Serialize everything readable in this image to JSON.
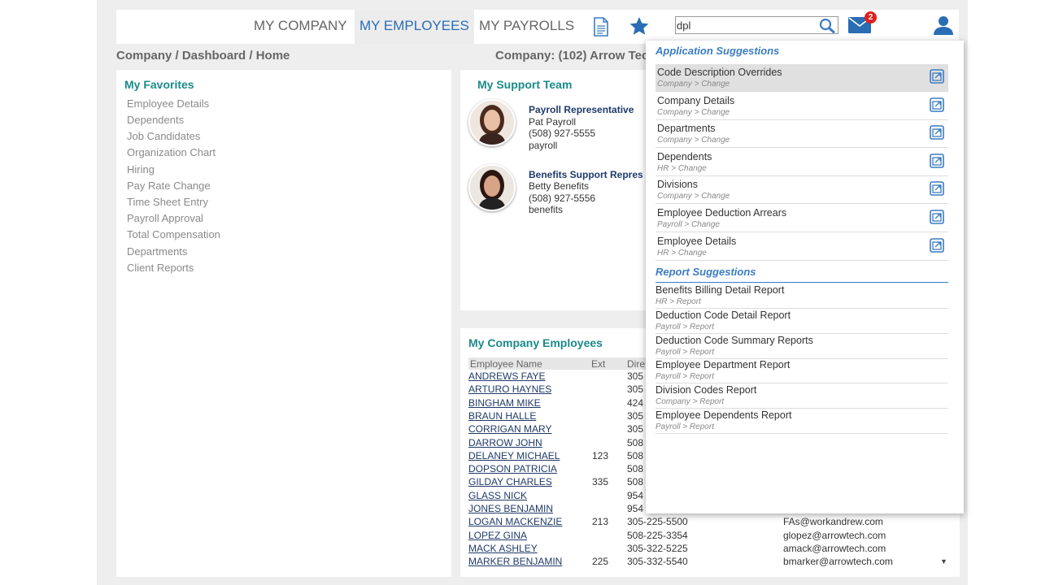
{
  "nav": {
    "items": [
      "MY COMPANY",
      "MY EMPLOYEES",
      "MY PAYROLLS"
    ],
    "active": "MY EMPLOYEES"
  },
  "header": {
    "search_value": "dpl",
    "mail_badge": "2"
  },
  "breadcrumb": "Company / Dashboard / Home",
  "company_label": "Company: (102) Arrow Tec",
  "favorites": {
    "title": "My Favorites",
    "items": [
      "Employee Details",
      "Dependents",
      "Job Candidates",
      "Organization Chart",
      "Hiring",
      "Pay Rate Change",
      "Time Sheet Entry",
      "Payroll Approval",
      "Total Compensation",
      "Departments",
      "Client Reports"
    ]
  },
  "support": {
    "title": "My Support Team",
    "members": [
      {
        "role": "Payroll Representative",
        "name": "Pat Payroll",
        "phone": "(508) 927-5555",
        "email": "payroll"
      },
      {
        "role": "Benefits Support Repres",
        "name": "Betty Benefits",
        "phone": "(508) 927-5556",
        "email": "benefits"
      }
    ]
  },
  "employees": {
    "title": "My Company Employees",
    "columns": [
      "Employee Name",
      "Ext",
      "Dire"
    ],
    "rows": [
      {
        "name": "ANDREWS FAYE",
        "ext": "",
        "phone": "305",
        "email": ""
      },
      {
        "name": "ARTURO HAYNES",
        "ext": "",
        "phone": "305",
        "email": ""
      },
      {
        "name": "BINGHAM MIKE",
        "ext": "",
        "phone": "424",
        "email": ""
      },
      {
        "name": "BRAUN HALLE",
        "ext": "",
        "phone": "305",
        "email": ""
      },
      {
        "name": "CORRIGAN MARY",
        "ext": "",
        "phone": "305",
        "email": ""
      },
      {
        "name": "DARROW JOHN",
        "ext": "",
        "phone": "508",
        "email": ""
      },
      {
        "name": "DELANEY MICHAEL",
        "ext": "123",
        "phone": "508",
        "email": ""
      },
      {
        "name": "DOPSON PATRICIA",
        "ext": "",
        "phone": "508",
        "email": ""
      },
      {
        "name": "GILDAY CHARLES",
        "ext": "335",
        "phone": "508",
        "email": ""
      },
      {
        "name": "GLASS NICK",
        "ext": "",
        "phone": "954",
        "email": ""
      },
      {
        "name": "JONES BENJAMIN",
        "ext": "",
        "phone": "954",
        "email": ""
      },
      {
        "name": "LOGAN MACKENZIE",
        "ext": "213",
        "phone": "305-225-5500",
        "email": "FAs@workandrew.com"
      },
      {
        "name": "LOPEZ GINA",
        "ext": "",
        "phone": "508-225-3354",
        "email": "glopez@arrowtech.com"
      },
      {
        "name": "MACK ASHLEY",
        "ext": "",
        "phone": "305-322-5225",
        "email": "amack@arrowtech.com"
      },
      {
        "name": "MARKER BENJAMIN",
        "ext": "225",
        "phone": "305-332-5540",
        "email": "bmarker@arrowtech.com"
      }
    ]
  },
  "suggestions": {
    "app_title": "Application Suggestions",
    "app": [
      {
        "title": "Code Description Overrides",
        "path": "Company > Change"
      },
      {
        "title": "Company Details",
        "path": "Company > Change"
      },
      {
        "title": "Departments",
        "path": "Company > Change"
      },
      {
        "title": "Dependents",
        "path": "HR > Change"
      },
      {
        "title": "Divisions",
        "path": "Company > Change"
      },
      {
        "title": "Employee Deduction Arrears",
        "path": "Payroll > Change"
      },
      {
        "title": "Employee Details",
        "path": "HR > Change"
      }
    ],
    "report_title": "Report Suggestions",
    "reports": [
      {
        "title": "Benefits Billing Detail Report",
        "path": "HR > Report"
      },
      {
        "title": "Deduction Code Detail Report",
        "path": "Payroll > Report"
      },
      {
        "title": "Deduction Code Summary Reports",
        "path": "Payroll > Report"
      },
      {
        "title": "Employee Department Report",
        "path": "Payroll > Report"
      },
      {
        "title": "Division Codes Report",
        "path": "Company > Report"
      },
      {
        "title": "Employee Dependents Report",
        "path": "Payroll > Report"
      }
    ]
  },
  "colors": {
    "accent": "#2a6db5",
    "teal": "#1b8a8a",
    "badge": "#e02020"
  },
  "icons": [
    "document-icon",
    "star-icon",
    "search-icon",
    "mail-icon",
    "user-icon",
    "open-window-icon",
    "scroll-down-icon"
  ]
}
